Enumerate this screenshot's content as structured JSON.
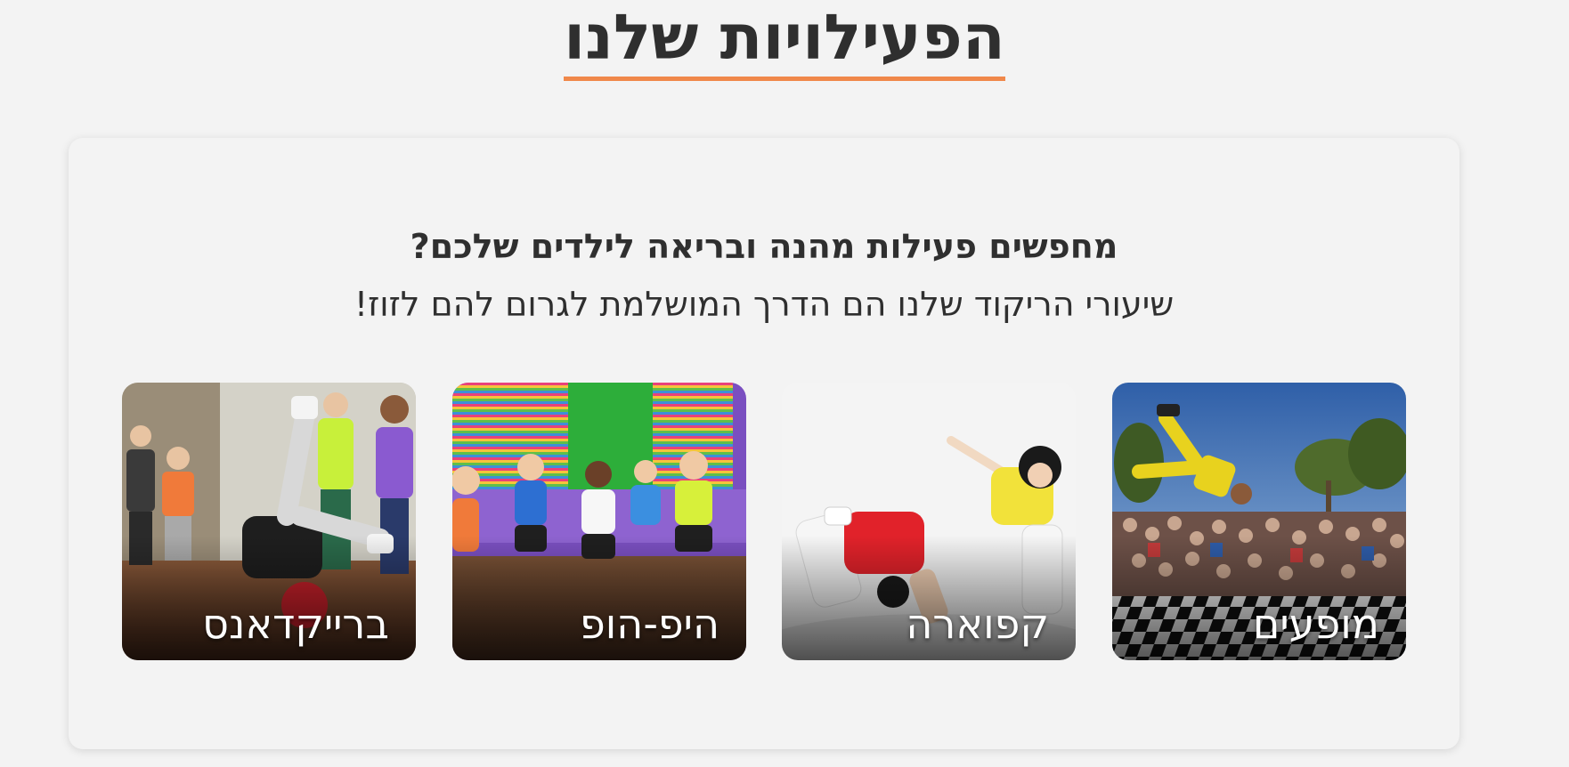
{
  "section": {
    "title": "הפעילויות שלנו",
    "accent_color": "#f0884a"
  },
  "card": {
    "heading": "מחפשים פעילות מהנה ובריאה לילדים שלכם?",
    "subheading": "שיעורי הריקוד שלנו הם הדרך המושלמת לגרום להם לזוז!"
  },
  "activities": [
    {
      "label": "מופעים",
      "image": "street-performance-photo"
    },
    {
      "label": "קפוארה",
      "image": "capoeira-kids-photo"
    },
    {
      "label": "היפ-הופ",
      "image": "hiphop-class-photo"
    },
    {
      "label": "ברייקדאנס",
      "image": "breakdance-kid-photo"
    }
  ]
}
